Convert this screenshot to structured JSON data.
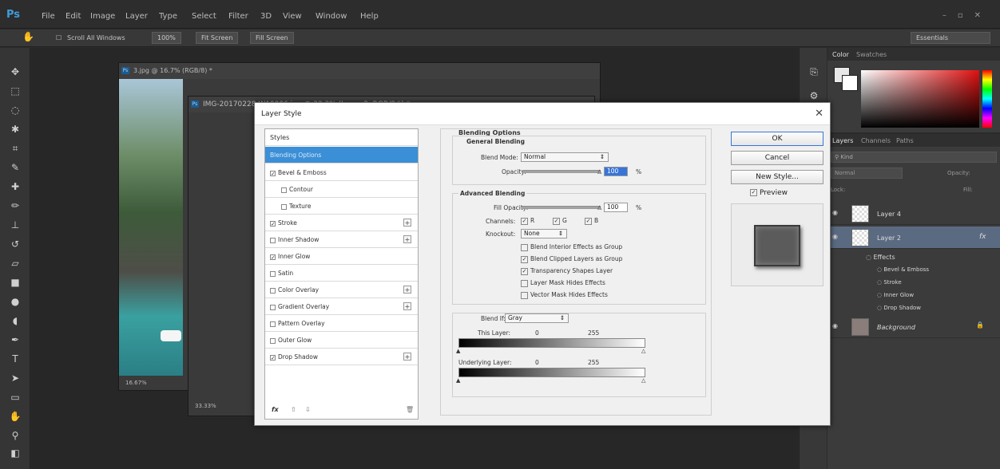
{
  "app": {
    "logo": "Ps",
    "menus": [
      "File",
      "Edit",
      "Image",
      "Layer",
      "Type",
      "Select",
      "Filter",
      "3D",
      "View",
      "Window",
      "Help"
    ]
  },
  "options_bar": {
    "scroll_all": "Scroll All Windows",
    "zoom": "100%",
    "fit_screen": "Fit Screen",
    "fill_screen": "Fill Screen",
    "workspace": "Essentials"
  },
  "documents": {
    "doc1_title": "3.jpg @ 16.7% (RGB/8) *",
    "doc1_zoom": "16.67%",
    "doc2_title": "IMG-20170228-WA0006.jpg @ 33.3% (Layer 2, RGB/8#) *",
    "doc2_zoom": "33.33%"
  },
  "dialog": {
    "title": "Layer Style",
    "styles_header": "Styles",
    "styles": [
      {
        "label": "Blending Options",
        "selected": true,
        "check": false,
        "plus": false,
        "hasbox": false
      },
      {
        "label": "Bevel & Emboss",
        "checked": true,
        "plus": false,
        "hasbox": true
      },
      {
        "label": "Contour",
        "checked": false,
        "indent": true,
        "plus": false,
        "hasbox": true
      },
      {
        "label": "Texture",
        "checked": false,
        "indent": true,
        "plus": false,
        "hasbox": true
      },
      {
        "label": "Stroke",
        "checked": true,
        "plus": true,
        "hasbox": true
      },
      {
        "label": "Inner Shadow",
        "checked": false,
        "plus": true,
        "hasbox": true
      },
      {
        "label": "Inner Glow",
        "checked": true,
        "plus": false,
        "hasbox": true
      },
      {
        "label": "Satin",
        "checked": false,
        "plus": false,
        "hasbox": true
      },
      {
        "label": "Color Overlay",
        "checked": false,
        "plus": true,
        "hasbox": true
      },
      {
        "label": "Gradient Overlay",
        "checked": false,
        "plus": true,
        "hasbox": true
      },
      {
        "label": "Pattern Overlay",
        "checked": false,
        "plus": false,
        "hasbox": true
      },
      {
        "label": "Outer Glow",
        "checked": false,
        "plus": false,
        "hasbox": true
      },
      {
        "label": "Drop Shadow",
        "checked": true,
        "plus": true,
        "hasbox": true
      }
    ],
    "footer_fx": "fx",
    "blending": {
      "section_title": "Blending Options",
      "general_title": "General Blending",
      "blend_mode_label": "Blend Mode:",
      "blend_mode_value": "Normal",
      "opacity_label": "Opacity:",
      "opacity_value": "100",
      "percent": "%",
      "advanced_title": "Advanced Blending",
      "fill_opacity_label": "Fill Opacity:",
      "fill_opacity_value": "100",
      "channels_label": "Channels:",
      "channel_r": "R",
      "channel_g": "G",
      "channel_b": "B",
      "knockout_label": "Knockout:",
      "knockout_value": "None",
      "opt_interior": "Blend Interior Effects as Group",
      "opt_clipped": "Blend Clipped Layers as Group",
      "opt_transparency": "Transparency Shapes Layer",
      "opt_mask": "Layer Mask Hides Effects",
      "opt_vector": "Vector Mask Hides Effects",
      "blend_if_label": "Blend If:",
      "blend_if_value": "Gray",
      "this_layer_label": "This Layer:",
      "this_layer_min": "0",
      "this_layer_max": "255",
      "underlying_label": "Underlying Layer:",
      "underlying_min": "0",
      "underlying_max": "255"
    },
    "buttons": {
      "ok": "OK",
      "cancel": "Cancel",
      "new_style": "New Style...",
      "preview": "Preview"
    }
  },
  "color_panel": {
    "tab_color": "Color",
    "tab_swatches": "Swatches"
  },
  "layers_panel": {
    "tab_layers": "Layers",
    "tab_channels": "Channels",
    "tab_paths": "Paths",
    "kind": "Kind",
    "blend": "Normal",
    "opacity_label": "Opacity:",
    "lock_label": "Lock:",
    "fill_label": "Fill:",
    "layers": [
      "Layer 4",
      "Layer 2"
    ],
    "effects_label": "Effects",
    "effects": [
      "Bevel & Emboss",
      "Stroke",
      "Inner Glow",
      "Drop Shadow"
    ],
    "background": "Background",
    "fx": "fx"
  }
}
